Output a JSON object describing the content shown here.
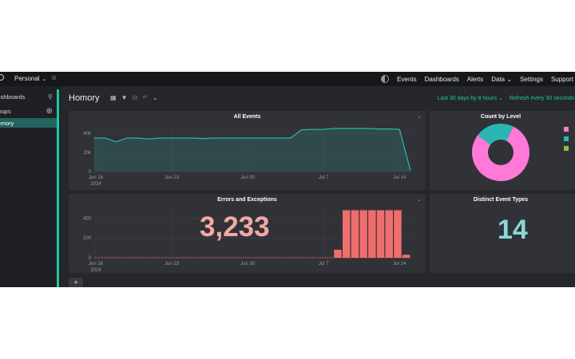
{
  "topbar": {
    "org": "Personal",
    "nav": [
      "Events",
      "Dashboards",
      "Alerts",
      "Data",
      "Settings",
      "Support"
    ],
    "data_chevron": "⌄",
    "theme_icon": "theme-toggle-icon"
  },
  "sidebar": {
    "items": [
      {
        "label": "Dashboards",
        "icon": "search-icon",
        "icon_glyph": "⚲"
      },
      {
        "label": "Groups",
        "icon": "add-circle-icon",
        "icon_glyph": "⊕"
      },
      {
        "label": "Homory",
        "active": true
      }
    ]
  },
  "dashboard": {
    "title": "Homory",
    "time_range": "Last 30 days by 8 hours ⌄",
    "refresh": "Refresh every 30 seconds ⌄"
  },
  "panels": {
    "all_events": {
      "title": "All Events",
      "menu": "⌄"
    },
    "count_by_level": {
      "title": "Count by Level"
    },
    "errors": {
      "title": "Errors and Exceptions",
      "menu": "⌄",
      "value": "3,233"
    },
    "distinct": {
      "title": "Distinct Event Types",
      "value": "14"
    }
  },
  "add_button": "+",
  "colors": {
    "accent": "#1ec8a6",
    "line": "#2ab7a9",
    "errors": "#f06d6d",
    "pink": "#ff79d8",
    "teal": "#2ab7b3",
    "green": "#8bc34a",
    "distinct_value": "#8ad8d8",
    "error_value": "#f5a8a3"
  },
  "chart_data": [
    {
      "type": "area",
      "title": "All Events",
      "x_ticks": [
        "Jun 16\n2024",
        "Jun 23",
        "Jun 30",
        "Jul 7",
        "Jul 14"
      ],
      "y_ticks": [
        "0",
        "20k",
        "40k"
      ],
      "ylim": [
        0,
        50000
      ],
      "x": [
        "Jun 16",
        "Jun 17",
        "Jun 18",
        "Jun 19",
        "Jun 20",
        "Jun 21",
        "Jun 22",
        "Jun 23",
        "Jun 24",
        "Jun 25",
        "Jun 26",
        "Jun 27",
        "Jun 28",
        "Jun 29",
        "Jun 30",
        "Jul 1",
        "Jul 2",
        "Jul 3",
        "Jul 4",
        "Jul 5",
        "Jul 6",
        "Jul 7",
        "Jul 8",
        "Jul 9",
        "Jul 10",
        "Jul 11",
        "Jul 12",
        "Jul 13",
        "Jul 14",
        "Jul 15"
      ],
      "values": [
        35000,
        35000,
        31000,
        35000,
        35000,
        34000,
        35000,
        35000,
        35000,
        35000,
        34500,
        35000,
        35000,
        35000,
        35000,
        35000,
        35000,
        35000,
        35000,
        43500,
        44000,
        44000,
        45000,
        45000,
        45000,
        45000,
        44500,
        44500,
        44000,
        1000
      ]
    },
    {
      "type": "pie",
      "title": "Count by Level",
      "values": [
        0.78,
        0.22
      ],
      "colors": [
        "#ff79d8",
        "#2ab7b3"
      ],
      "legend_colors": [
        "#ff79d8",
        "#2ab7b3",
        "#8bc34a"
      ]
    },
    {
      "type": "bar",
      "title": "Errors and Exceptions",
      "x_ticks": [
        "Jun 16\n2024",
        "Jun 23",
        "Jun 30",
        "Jul 7",
        "Jul 14"
      ],
      "y_ticks": [
        "0",
        "200",
        "400"
      ],
      "ylim": [
        0,
        500
      ],
      "values": [
        0,
        0,
        0,
        0,
        0,
        0,
        0,
        0,
        0,
        0,
        0,
        0,
        0,
        0,
        0,
        0,
        0,
        0,
        0,
        0,
        0,
        0,
        0,
        0,
        0,
        0,
        0,
        0,
        80,
        480,
        480,
        480,
        480,
        480,
        480,
        480,
        30
      ]
    }
  ]
}
